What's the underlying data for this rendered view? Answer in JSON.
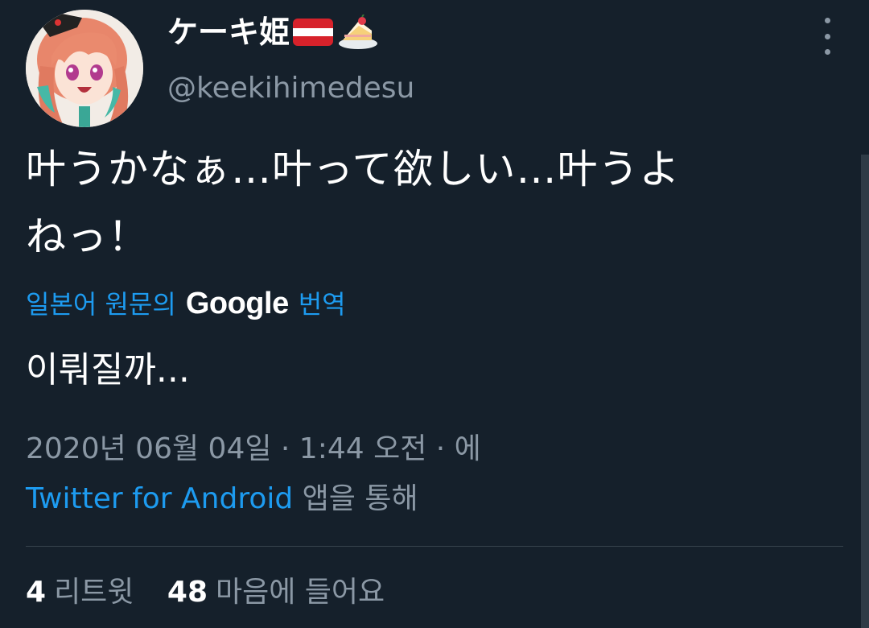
{
  "author": {
    "display_name": "ケーキ姫",
    "handle": "@keekihimedesu",
    "flag_colors": [
      "#d7222b",
      "#ffffff",
      "#d7222b"
    ],
    "emoji_icons": [
      "austria-flag-icon",
      "cake-icon"
    ]
  },
  "tweet": {
    "text": "叶うかなぁ…叶って欲しい…叶うよ\nねっ！",
    "translation_prefix": "일본어 원문의",
    "translation_brand": "Google",
    "translation_suffix": "번역",
    "translated_text": "이뤄질까...",
    "date_line": "2020년 06월 04일 · 1:44 오전 · 에",
    "source": "Twitter for Android",
    "source_suffix": " 앱을 통해"
  },
  "stats": {
    "retweets_count": "4",
    "retweets_label": "리트윗",
    "likes_count": "48",
    "likes_label": "마음에 들어요"
  },
  "colors": {
    "background": "#15202b",
    "accent": "#1d9bf0",
    "secondary_text": "#8b98a5",
    "divider": "#38444d"
  }
}
